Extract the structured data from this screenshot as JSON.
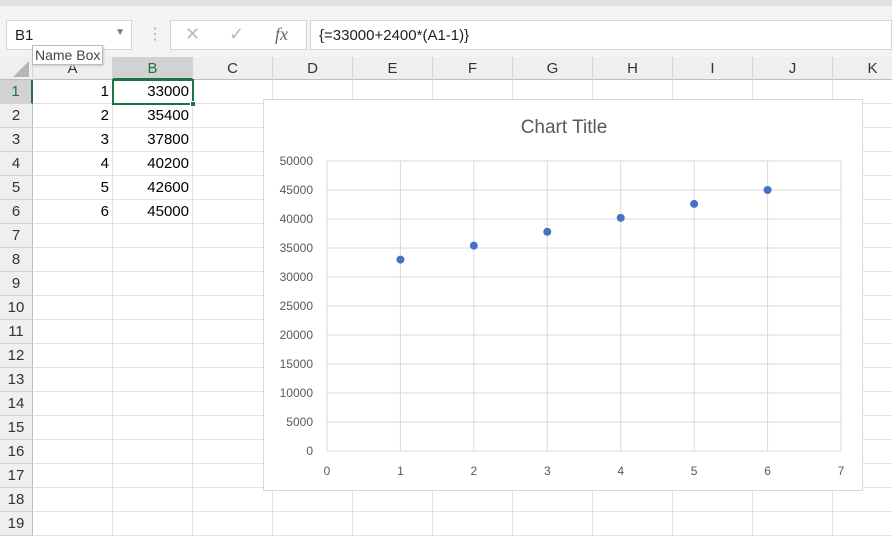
{
  "formula_bar": {
    "name_box": "B1",
    "name_box_tooltip": "Name Box",
    "cancel_icon": "✕",
    "enter_icon": "✓",
    "fx_label": "fx",
    "formula": "{=33000+2400*(A1-1)}"
  },
  "columns": [
    "A",
    "B",
    "C",
    "D",
    "E",
    "F",
    "G",
    "H",
    "I",
    "J",
    "K"
  ],
  "rows": [
    "1",
    "2",
    "3",
    "4",
    "5",
    "6",
    "7",
    "8",
    "9",
    "10",
    "11",
    "12",
    "13",
    "14",
    "15",
    "16",
    "17",
    "18",
    "19"
  ],
  "cells": {
    "A": [
      "1",
      "2",
      "3",
      "4",
      "5",
      "6"
    ],
    "B": [
      "33000",
      "35400",
      "37800",
      "40200",
      "42600",
      "45000"
    ]
  },
  "selected_cell": "B1",
  "colors": {
    "accent": "#217346",
    "series": "#4472c4"
  },
  "chart_data": {
    "type": "scatter",
    "title": "Chart Title",
    "x": [
      1,
      2,
      3,
      4,
      5,
      6
    ],
    "y": [
      33000,
      35400,
      37800,
      40200,
      42600,
      45000
    ],
    "xlim": [
      0,
      7
    ],
    "ylim": [
      0,
      50000
    ],
    "xticks": [
      "0",
      "1",
      "2",
      "3",
      "4",
      "5",
      "6",
      "7"
    ],
    "yticks": [
      "0",
      "5000",
      "10000",
      "15000",
      "20000",
      "25000",
      "30000",
      "35000",
      "40000",
      "45000",
      "50000"
    ],
    "grid": true,
    "legend": "none"
  }
}
